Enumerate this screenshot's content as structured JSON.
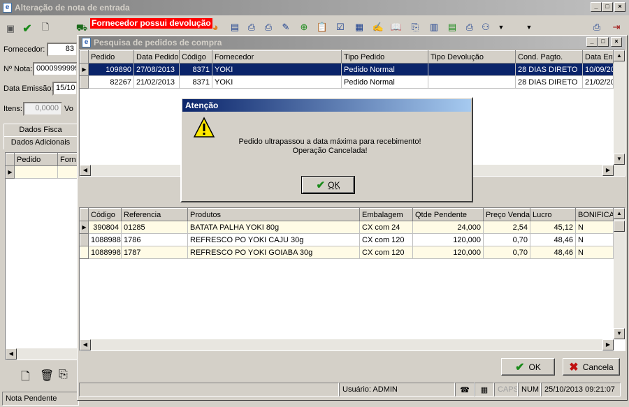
{
  "main_window": {
    "title": "Alteração de nota de entrada",
    "warning_banner": "Fornecedor possui devolução",
    "fields": {
      "fornecedor_label": "Fornecedor:",
      "fornecedor_value": "83",
      "nota_label": "Nº Nota:",
      "nota_value": "0000999999",
      "data_emissao_label": "Data Emissão:",
      "data_emissao_value": "15/10",
      "itens_label": "Itens:",
      "itens_value": "0,0000",
      "vo_label": "Vo"
    },
    "tabs": [
      "Dados Fisca",
      "Dados Adicionais"
    ],
    "left_grid_headers": [
      "Pedido",
      "Forn"
    ],
    "status_left": "Nota Pendente",
    "status_behind_user": "Usuário: ADMIN",
    "status_behind_date": "25/10/2013 09:21:07"
  },
  "search_window": {
    "title": "Pesquisa de pedidos de compra",
    "orders_headers": [
      "Pedido",
      "Data Pedido",
      "Código",
      "Fornecedor",
      "Tipo Pedido",
      "Tipo Devolução",
      "Cond. Pagto.",
      "Data Ent"
    ],
    "orders": [
      [
        "109890",
        "27/08/2013",
        "8371",
        "YOKI",
        "Pedido Normal",
        "",
        "28 DIAS DIRETO",
        "10/09/20"
      ],
      [
        "82267",
        "21/02/2013",
        "8371",
        "YOKI",
        "Pedido Normal",
        "",
        "28 DIAS DIRETO",
        "21/02/20"
      ]
    ],
    "items_headers": [
      "Código",
      "Referencia",
      "Produtos",
      "Embalagem",
      "Qtde Pendente",
      "Preço Venda",
      "Lucro",
      "BONIFICA("
    ],
    "items": [
      [
        "390804",
        "01285",
        "BATATA PALHA YOKI 80g",
        "CX com 24",
        "24,000",
        "2,54",
        "45,12",
        "N"
      ],
      [
        "1088988",
        "1786",
        "REFRESCO PO YOKI CAJU 30g",
        "CX com 120",
        "120,000",
        "0,70",
        "48,46",
        "N"
      ],
      [
        "1088998",
        "1787",
        "REFRESCO PO YOKI GOIABA 30g",
        "CX com 120",
        "120,000",
        "0,70",
        "48,46",
        "N"
      ]
    ],
    "ok_label": "OK",
    "cancel_label": "Cancela",
    "status": {
      "user": "Usuário: ADMIN",
      "caps": "CAPS",
      "num": "NUM",
      "datetime": "25/10/2013 09:21:07"
    }
  },
  "dialog": {
    "title": "Atenção",
    "message": "Pedido ultrapassou a data máxima para recebimento! Operação Cancelada!",
    "ok_label": "OK"
  },
  "colors": {
    "title_active": "#0a246a",
    "selection": "#0a246a",
    "warning_banner": "#ff0000",
    "row_highlight": "#fffbe6"
  }
}
